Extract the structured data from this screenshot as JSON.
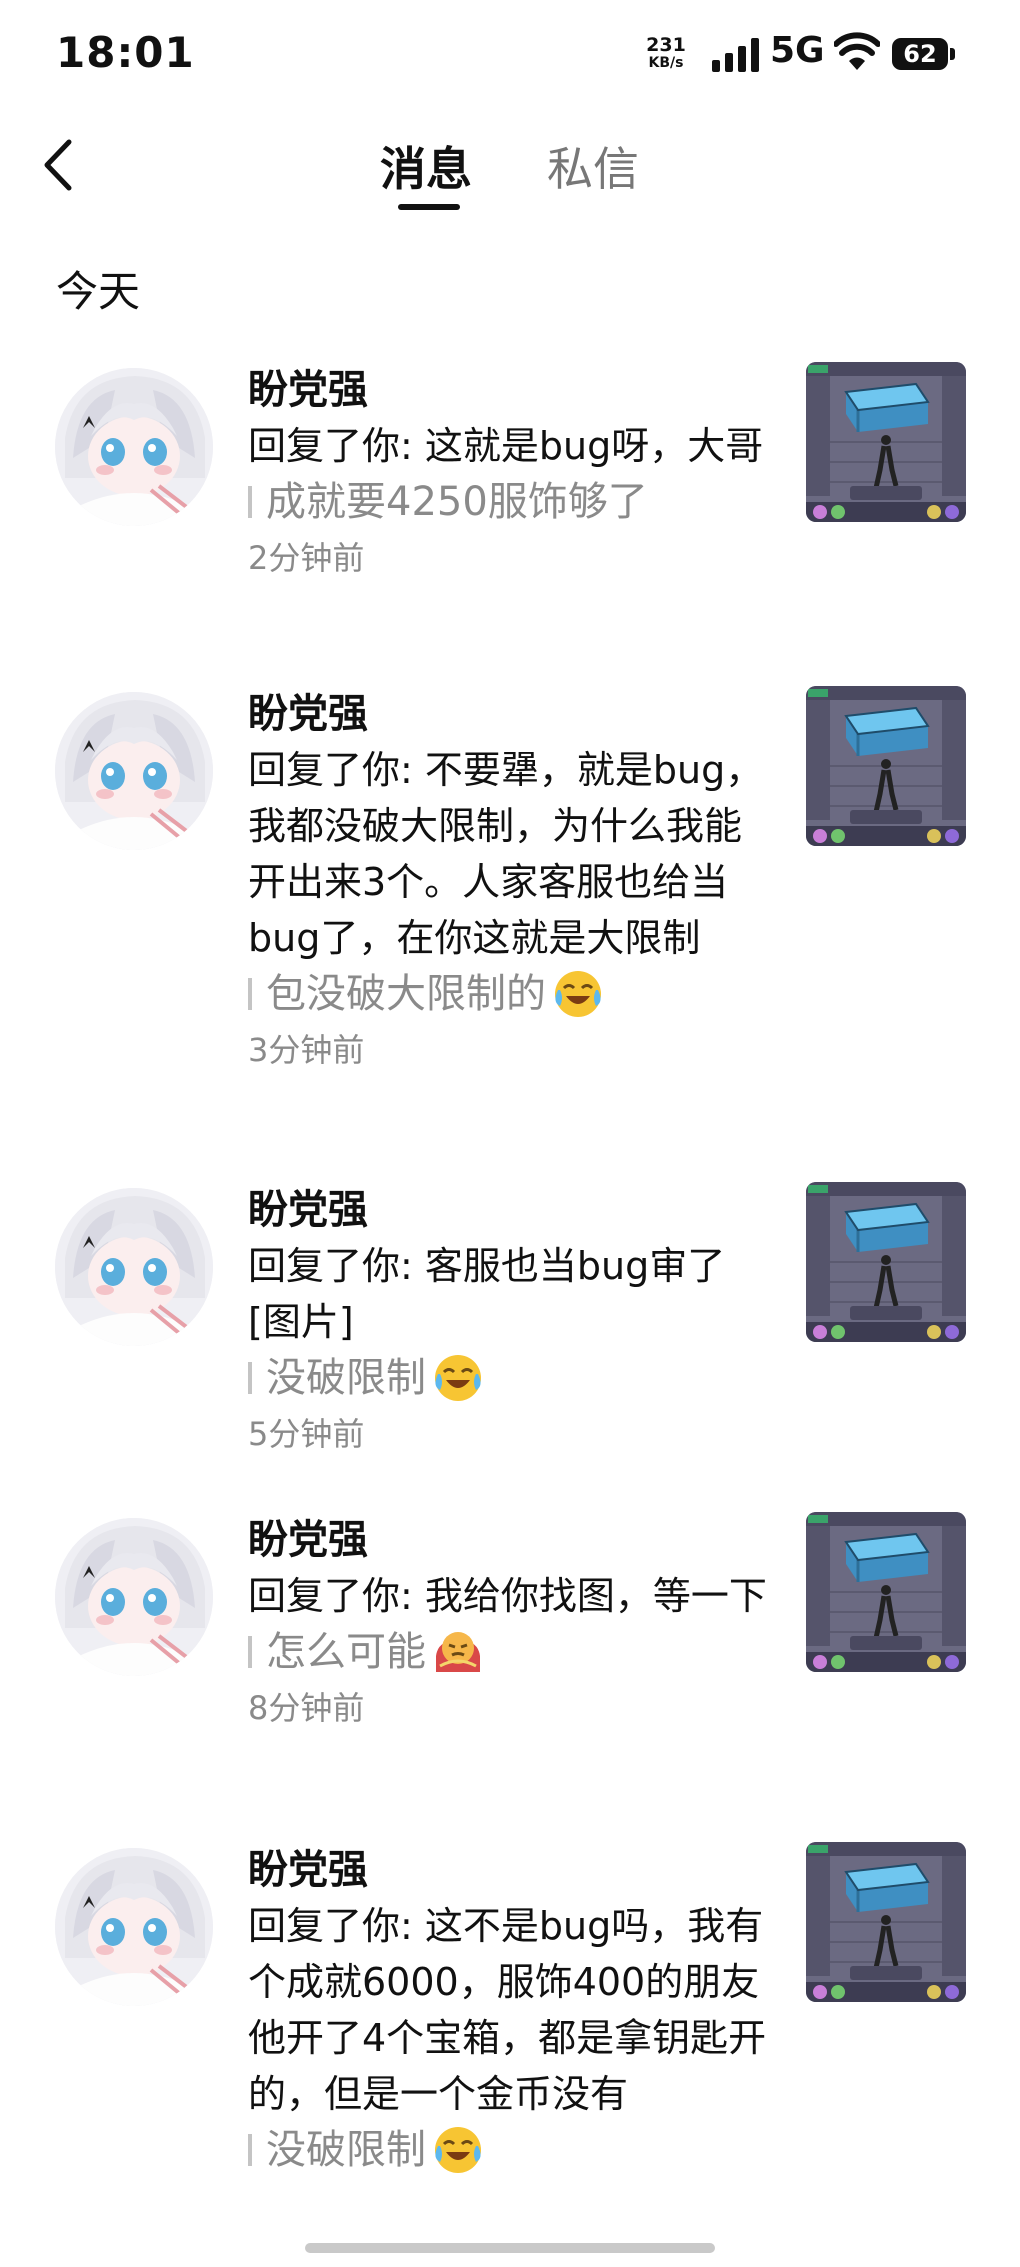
{
  "status_bar": {
    "time": "18:01",
    "net_speed_value": "231",
    "net_speed_unit": "KB/s",
    "network": "5G",
    "battery": "62"
  },
  "header": {
    "tabs": [
      {
        "label": "消息",
        "active": true
      },
      {
        "label": "私信",
        "active": false
      }
    ]
  },
  "section": {
    "title": "今天"
  },
  "notifications": [
    {
      "name": "盼党强",
      "message": "回复了你: 这就是bug呀，大哥",
      "quote": "成就要4250服饰够了",
      "emoji": "",
      "time": "2分钟前"
    },
    {
      "name": "盼党强",
      "message": "回复了你: 不要犟，就是bug，我都没破大限制，为什么我能开出来3个。人家客服也给当bug了，在你这就是大限制",
      "quote": "包没破大限制的",
      "emoji": "laughing-crying-emoji",
      "time": "3分钟前"
    },
    {
      "name": "盼党强",
      "message": "回复了你: 客服也当bug审了[图片]",
      "quote": "没破限制",
      "emoji": "laughing-crying-emoji",
      "time": "5分钟前"
    },
    {
      "name": "盼党强",
      "message": "回复了你: 我给你找图，等一下",
      "quote": "怎么可能",
      "emoji": "sulking-emoji",
      "time": "8分钟前"
    },
    {
      "name": "盼党强",
      "message": "回复了你: 这不是bug吗，我有个成就6000，服饰400的朋友他开了4个宝箱，都是拿钥匙开的，但是一个金币没有",
      "quote": "没破限制",
      "emoji": "laughing-crying-emoji",
      "time": ""
    }
  ],
  "colors": {
    "text": "#111111",
    "secondary": "#8a8a8a",
    "quote_bar": "#c4c4c4",
    "game_floor": "#6b6a82",
    "chest": "#4aa7d8"
  }
}
